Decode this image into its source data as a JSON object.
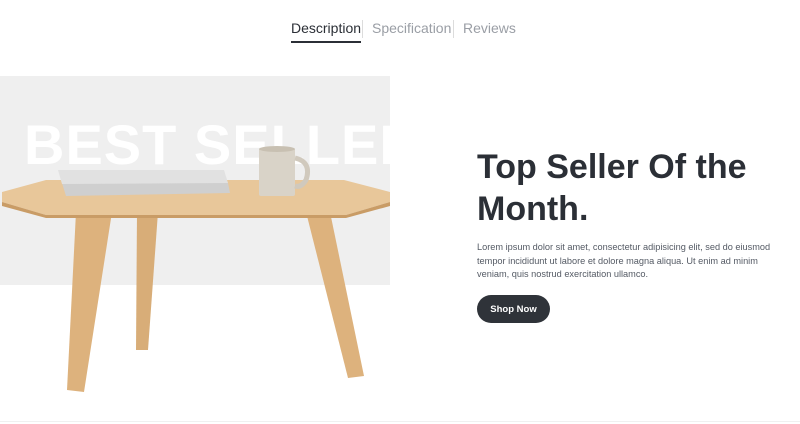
{
  "tabs": [
    {
      "label": "Description",
      "active": true
    },
    {
      "label": "Specification",
      "active": false
    },
    {
      "label": "Reviews",
      "active": false
    }
  ],
  "hero": {
    "watermark": "BEST SELLER",
    "headline_line1": "Top Seller Of the",
    "headline_line2": "Month.",
    "body": "Lorem ipsum dolor sit amet, consectetur adipisicing elit, sed do eiusmod tempor incididunt ut labore et dolore magna aliqua. Ut enim ad minim veniam, quis nostrud exercitation ullamco.",
    "cta_label": "Shop Now"
  },
  "colors": {
    "text_dark": "#2b2f36",
    "text_muted": "#9a9ea5",
    "button_bg": "#2f3339",
    "hero_bg": "#efefef",
    "wood": "#e8c79a"
  }
}
